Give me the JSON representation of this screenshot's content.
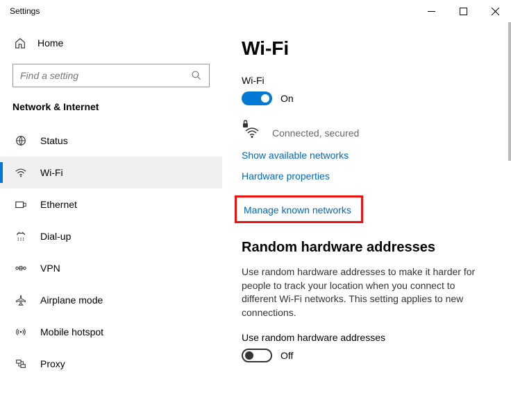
{
  "window": {
    "title": "Settings"
  },
  "sidebar": {
    "home": "Home",
    "search_placeholder": "Find a setting",
    "category": "Network & Internet",
    "items": [
      {
        "label": "Status"
      },
      {
        "label": "Wi-Fi"
      },
      {
        "label": "Ethernet"
      },
      {
        "label": "Dial-up"
      },
      {
        "label": "VPN"
      },
      {
        "label": "Airplane mode"
      },
      {
        "label": "Mobile hotspot"
      },
      {
        "label": "Proxy"
      }
    ]
  },
  "main": {
    "title": "Wi-Fi",
    "wifi_label": "Wi-Fi",
    "wifi_on": "On",
    "status": "Connected, secured",
    "link_show": "Show available networks",
    "link_hw": "Hardware properties",
    "link_manage": "Manage known networks",
    "random_title": "Random hardware addresses",
    "random_desc": "Use random hardware addresses to make it harder for people to track your location when you connect to different Wi-Fi networks. This setting applies to new connections.",
    "random_toggle_label": "Use random hardware addresses",
    "random_off": "Off"
  }
}
